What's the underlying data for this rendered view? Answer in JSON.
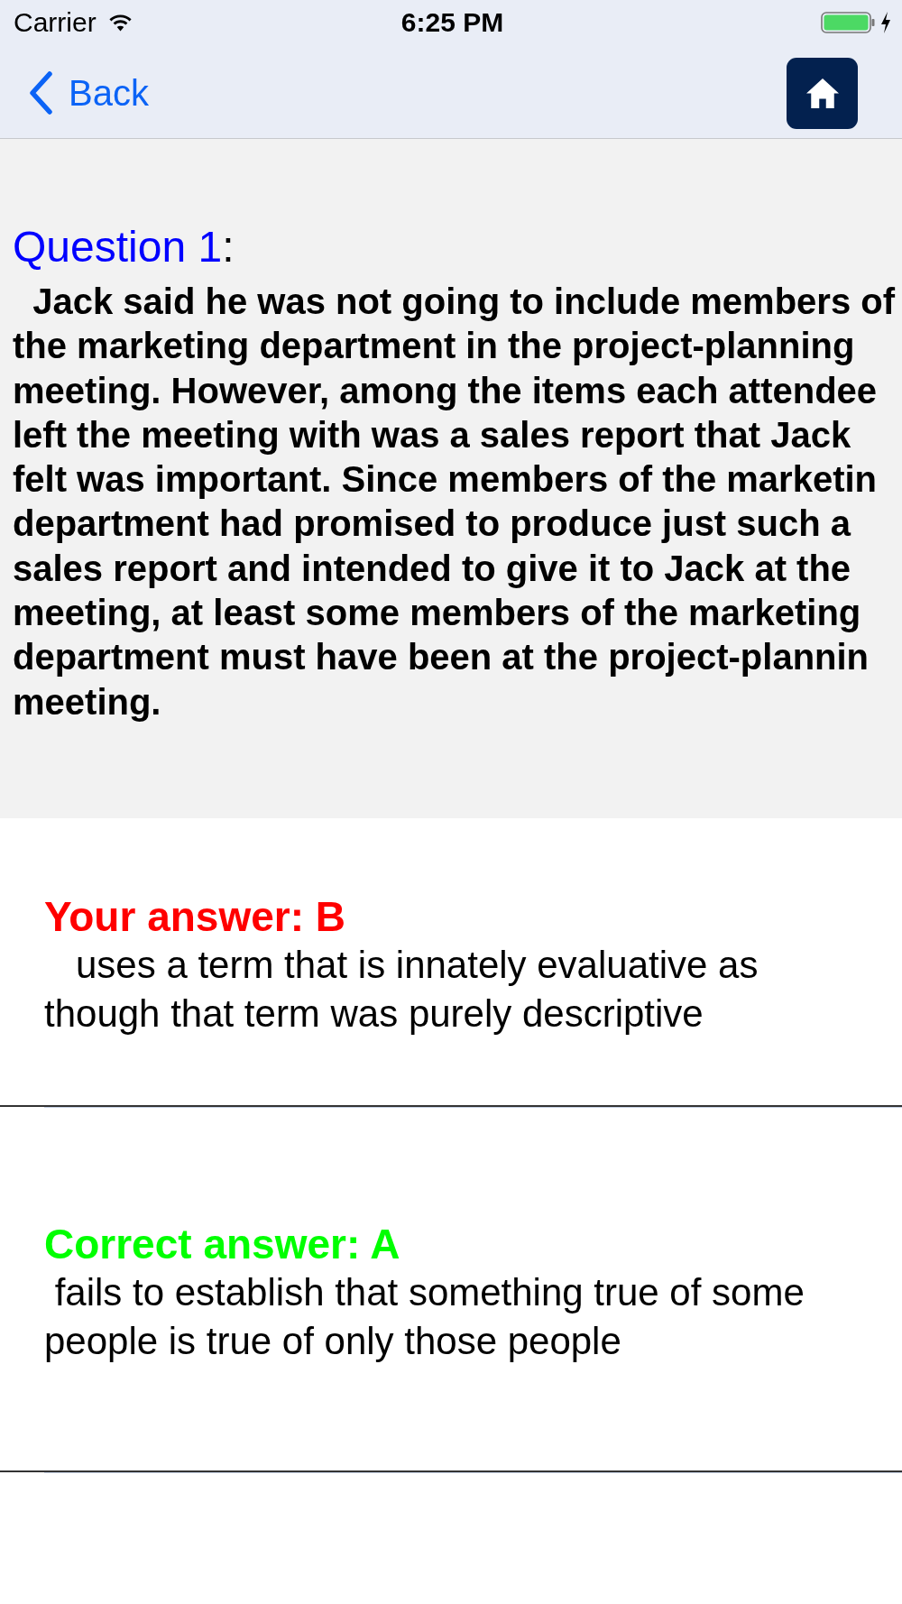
{
  "status_bar": {
    "carrier": "Carrier",
    "time": "6:25 PM"
  },
  "nav_bar": {
    "back": "Back"
  },
  "question": {
    "label": "Question 1",
    "suffix": ":",
    "lines": [
      "  Jack said he was not going to include members of",
      "the marketing department in the project-planning",
      "meeting. However, among the items each attendee",
      "left the meeting with was a sales report that Jack",
      "felt was important. Since members of the marketin",
      "department had promised to produce just such a",
      "sales report and intended to give it to Jack at the",
      "meeting, at least some members of the marketing",
      "department must have been at the project-plannin",
      "meeting."
    ]
  },
  "answers": [
    {
      "heading": "Your answer: B",
      "color": "#ff0000",
      "lines": [
        "   uses a term that is innately evaluative as",
        "though that term was purely descriptive"
      ]
    },
    {
      "heading": "Correct answer: A",
      "color": "#00ff00",
      "lines": [
        " fails to establish that something true of some",
        "people is true of only those people"
      ]
    }
  ]
}
